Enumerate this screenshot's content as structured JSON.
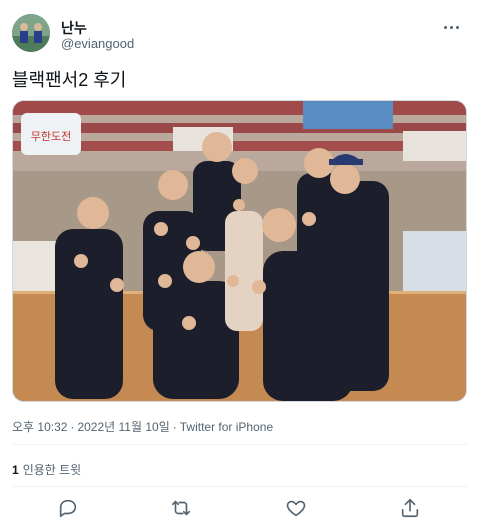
{
  "author": {
    "name": "난누",
    "handle": "@eviangood"
  },
  "tweet": {
    "text": "블랙팬서2 후기"
  },
  "meta": {
    "time": "오후 10:32",
    "date": "2022년 11월 10일",
    "source": "Twitter for iPhone",
    "separator": "·"
  },
  "stats": {
    "quote_count": "1",
    "quote_label": "인용한 트윗"
  },
  "photo": {
    "banner_text": "무한도전"
  },
  "icons": {
    "more": "more-dots-icon",
    "reply": "reply-icon",
    "retweet": "retweet-icon",
    "like": "heart-icon",
    "share": "share-icon"
  },
  "colors": {
    "primary_text": "#0f1419",
    "secondary_text": "#536471",
    "divider": "#eff3f4"
  }
}
